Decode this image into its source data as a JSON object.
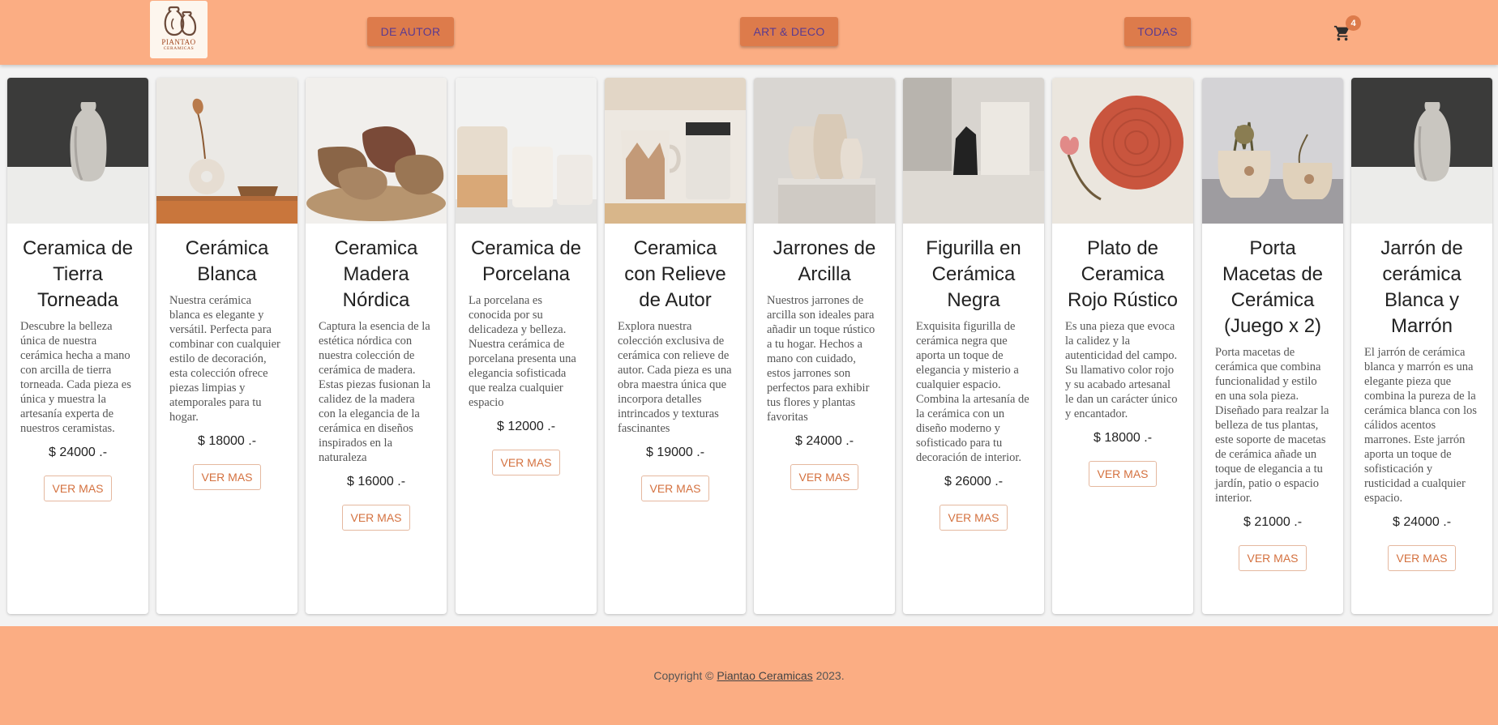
{
  "header": {
    "logo_text": "PIANTAO",
    "logo_subtext": "CERAMICAS",
    "nav": [
      {
        "label": "DE AUTOR"
      },
      {
        "label": "ART & DECO"
      },
      {
        "label": "TODAS"
      }
    ],
    "cart_icon": "cart-icon",
    "cart_count": "4"
  },
  "products": [
    {
      "title": "Ceramica de Tierra Torneada",
      "description": "Descubre la belleza única de nuestra cerámica hecha a mano con arcilla de tierra torneada. Cada pieza es única y muestra la artesanía experta de nuestros ceramistas.",
      "price": "$ 24000 .-",
      "button": "VER MAS"
    },
    {
      "title": "Cerámica Blanca",
      "description": "Nuestra cerámica blanca es elegante y versátil. Perfecta para combinar con cualquier estilo de decoración, esta colección ofrece piezas limpias y atemporales para tu hogar.",
      "price": "$ 18000 .-",
      "button": "VER MAS"
    },
    {
      "title": "Ceramica Madera Nórdica",
      "description": "Captura la esencia de la estética nórdica con nuestra colección de cerámica de madera. Estas piezas fusionan la calidez de la madera con la elegancia de la cerámica en diseños inspirados en la naturaleza",
      "price": "$ 16000 .-",
      "button": "VER MAS"
    },
    {
      "title": "Ceramica de Porcelana",
      "description": "La porcelana es conocida por su delicadeza y belleza. Nuestra cerámica de porcelana presenta una elegancia sofisticada que realza cualquier espacio",
      "price": "$ 12000 .-",
      "button": "VER MAS"
    },
    {
      "title": "Ceramica con Relieve de Autor",
      "description": "Explora nuestra colección exclusiva de cerámica con relieve de autor. Cada pieza es una obra maestra única que incorpora detalles intrincados y texturas fascinantes",
      "price": "$ 19000 .-",
      "button": "VER MAS"
    },
    {
      "title": "Jarrones de Arcilla",
      "description": "Nuestros jarrones de arcilla son ideales para añadir un toque rústico a tu hogar. Hechos a mano con cuidado, estos jarrones son perfectos para exhibir tus flores y plantas favoritas",
      "price": "$ 24000 .-",
      "button": "VER MAS"
    },
    {
      "title": "Figurilla en Cerámica Negra",
      "description": "Exquisita figurilla de cerámica negra que aporta un toque de elegancia y misterio a cualquier espacio. Combina la artesanía de la cerámica con un diseño moderno y sofisticado para tu decoración de interior.",
      "price": "$ 26000 .-",
      "button": "VER MAS"
    },
    {
      "title": "Plato de Ceramica Rojo Rústico",
      "description": "Es una pieza que evoca la calidez y la autenticidad del campo. Su llamativo color rojo y su acabado artesanal le dan un carácter único y encantador.",
      "price": "$ 18000 .-",
      "button": "VER MAS"
    },
    {
      "title": "Porta Macetas de Cerámica (Juego x 2)",
      "description": "Porta macetas de cerámica que combina funcionalidad y estilo en una sola pieza. Diseñado para realzar la belleza de tus plantas, este soporte de macetas de cerámica añade un toque de elegancia a tu jardín, patio o espacio interior.",
      "price": "$ 21000 .-",
      "button": "VER MAS"
    },
    {
      "title": "Jarrón de cerámica Blanca y Marrón",
      "description": "El jarrón de cerámica blanca y marrón es una elegante pieza que combina la pureza de la cerámica blanca con los cálidos acentos marrones. Este jarrón aporta un toque de sofisticación y rusticidad a cualquier espacio.",
      "price": "$ 24000 .-",
      "button": "VER MAS"
    }
  ],
  "footer": {
    "prefix": "Copyright ©",
    "link": "Piantao Ceramicas",
    "suffix": "2023."
  },
  "colors": {
    "brand": "#fbad83",
    "accent": "#dd7b4b",
    "button_text": "#d4713f"
  }
}
